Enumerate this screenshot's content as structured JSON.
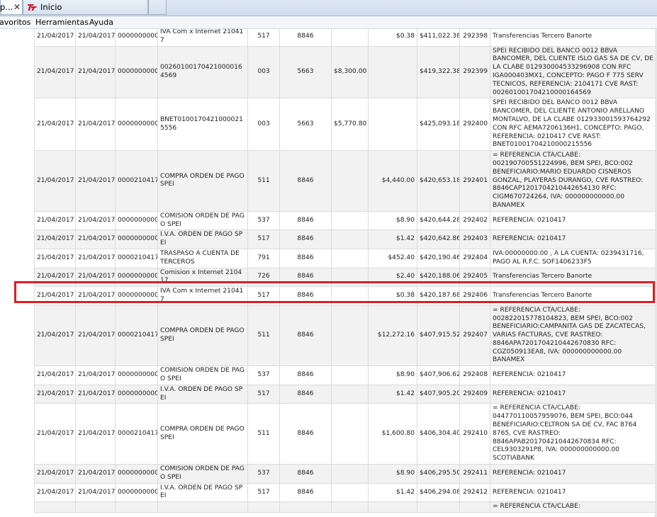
{
  "tabs": {
    "active": {
      "title": "p...",
      "close": "✕"
    },
    "inactive": {
      "title": "Inicio"
    }
  },
  "menu": {
    "favoritos": "avoritos",
    "herramientas": "Herramientas",
    "ayuda": "Ayuda"
  },
  "colors": {
    "highlight": "#e01c24",
    "logo": "#d3122a"
  },
  "rows": [
    {
      "fecha1": "21/04/2017",
      "fecha2": "21/04/2017",
      "ref": "0000000000",
      "desc": "IVA Com x Internet 210417",
      "cod": "517",
      "suc": "8846",
      "deposito": "",
      "retiro": "$0.38",
      "saldo": "$411,022.38",
      "mov": "292398",
      "referencia": "Transferencias Tercero Banorte"
    },
    {
      "fecha1": "21/04/2017",
      "fecha2": "21/04/2017",
      "ref": "0000000000",
      "desc": "002601001704210000164569",
      "cod": "003",
      "suc": "5663",
      "deposito": "$8,300.00",
      "retiro": "",
      "saldo": "$419,322.38",
      "mov": "292399",
      "referencia": "SPEI RECIBIDO DEL BANCO 0012 BBVA BANCOMER, DEL CLIENTE ISLO GAS SA DE CV, DE LA CLABE 012930004533296908 CON RFC IGA000403MX1, CONCEPTO: PAGO F 775 SERV TECNICOS, REFERENCIA: 2104171 CVE RAST: 002601001704210000164569"
    },
    {
      "fecha1": "21/04/2017",
      "fecha2": "21/04/2017",
      "ref": "0000000000",
      "desc": "BNET01001704210000215556",
      "cod": "003",
      "suc": "5663",
      "deposito": "$5,770.80",
      "retiro": "",
      "saldo": "$425,093.18",
      "mov": "292400",
      "referencia": "SPEI RECIBIDO DEL BANCO 0012 BBVA BANCOMER, DEL CLIENTE ANTONIO ARELLANO MONTALVO, DE LA CLABE 012933001593764292 CON RFC AEMA7206136H1, CONCEPTO: PAGO, REFERENCIA: 0210417 CVE RAST: BNET01001704210000215556"
    },
    {
      "fecha1": "21/04/2017",
      "fecha2": "21/04/2017",
      "ref": "0000210417",
      "desc": "COMPRA ORDEN DE PAGO SPEI",
      "cod": "511",
      "suc": "8846",
      "deposito": "",
      "retiro": "$4,440.00",
      "saldo": "$420,653.18",
      "mov": "292401",
      "referencia": "= REFERENCIA CTA/CLABE: 002190700551224996, BEM SPEI, BCO:002 BENEFICIARIO:MARIO EDUARDO CISNEROS GONZAL, PLAYERAS DURANGO, CVE RASTREO: 8846CAP1201704210442654130 RFC: CIGM670724264, IVA: 000000000000.00 BANAMEX"
    },
    {
      "fecha1": "21/04/2017",
      "fecha2": "21/04/2017",
      "ref": "0000000000",
      "desc": "COMISION ORDEN DE PAGO SPEI",
      "cod": "537",
      "suc": "8846",
      "deposito": "",
      "retiro": "$8.90",
      "saldo": "$420,644.28",
      "mov": "292402",
      "referencia": "REFERENCIA: 0210417"
    },
    {
      "fecha1": "21/04/2017",
      "fecha2": "21/04/2017",
      "ref": "0000000000",
      "desc": "I.V.A. ORDEN DE PAGO SPEI",
      "cod": "517",
      "suc": "8846",
      "deposito": "",
      "retiro": "$1.42",
      "saldo": "$420,642.86",
      "mov": "292403",
      "referencia": "REFERENCIA: 0210417"
    },
    {
      "fecha1": "21/04/2017",
      "fecha2": "21/04/2017",
      "ref": "0000210417",
      "desc": "TRASPASO A CUENTA DE TERCEROS",
      "cod": "791",
      "suc": "8846",
      "deposito": "",
      "retiro": "$452.40",
      "saldo": "$420,190.46",
      "mov": "292404",
      "referencia": "IVA:00000000.00 , A LA CUENTA: 0239431716, PAGO AL R.F.C. SOF1406233F5"
    },
    {
      "fecha1": "21/04/2017",
      "fecha2": "21/04/2017",
      "ref": "0000000000",
      "desc": "Comision x Internet 210417",
      "cod": "726",
      "suc": "8846",
      "deposito": "",
      "retiro": "$2.40",
      "saldo": "$420,188.06",
      "mov": "292405",
      "referencia": "Transferencias Tercero Banorte"
    },
    {
      "fecha1": "21/04/2017",
      "fecha2": "21/04/2017",
      "ref": "0000000000",
      "desc": "IVA Com x Internet 210417",
      "cod": "517",
      "suc": "8846",
      "deposito": "",
      "retiro": "$0.38",
      "saldo": "$420,187.68",
      "mov": "292406",
      "referencia": "Transferencias Tercero Banorte"
    },
    {
      "fecha1": "21/04/2017",
      "fecha2": "21/04/2017",
      "ref": "0000210417",
      "desc": "COMPRA ORDEN DE PAGO SPEI",
      "cod": "511",
      "suc": "8846",
      "deposito": "",
      "retiro": "$12,272.16",
      "saldo": "$407,915.52",
      "mov": "292407",
      "referencia": "= REFERENCIA CTA/CLABE: 002822015778104823, BEM SPEI, BCO:002 BENEFICIARIO:CAMPANITA GAS DE ZACATECAS, VARIAS FACTURAS, CVE RASTREO: 8846APA7201704210442670830 RFC: CGZ050913EA8, IVA: 000000000000.00 BANAMEX"
    },
    {
      "fecha1": "21/04/2017",
      "fecha2": "21/04/2017",
      "ref": "0000000000",
      "desc": "COMISION ORDEN DE PAGO SPEI",
      "cod": "537",
      "suc": "8846",
      "deposito": "",
      "retiro": "$8.90",
      "saldo": "$407,906.62",
      "mov": "292408",
      "referencia": "REFERENCIA: 0210417"
    },
    {
      "fecha1": "21/04/2017",
      "fecha2": "21/04/2017",
      "ref": "0000000000",
      "desc": "I.V.A. ORDEN DE PAGO SPEI",
      "cod": "517",
      "suc": "8846",
      "deposito": "",
      "retiro": "$1.42",
      "saldo": "$407,905.20",
      "mov": "292409",
      "referencia": "REFERENCIA: 0210417"
    },
    {
      "fecha1": "21/04/2017",
      "fecha2": "21/04/2017",
      "ref": "0000210417",
      "desc": "COMPRA ORDEN DE PAGO SPEI",
      "cod": "511",
      "suc": "8846",
      "deposito": "",
      "retiro": "$1,600.80",
      "saldo": "$406,304.40",
      "mov": "292410",
      "referencia": "= REFERENCIA CTA/CLABE: 044770110057959076, BEM SPEI, BCO:044 BENEFICIARIO:CELTRON SA DE CV, FAC 8764 8765, CVE RASTREO: 8846APAB201704210442670834 RFC: CEL9303291P8, IVA: 000000000000.00 SCOTIABANK"
    },
    {
      "fecha1": "21/04/2017",
      "fecha2": "21/04/2017",
      "ref": "0000000000",
      "desc": "COMISION ORDEN DE PAGO SPEI",
      "cod": "537",
      "suc": "8846",
      "deposito": "",
      "retiro": "$8.90",
      "saldo": "$406,295.50",
      "mov": "292411",
      "referencia": "REFERENCIA: 0210417"
    },
    {
      "fecha1": "21/04/2017",
      "fecha2": "21/04/2017",
      "ref": "0000000000",
      "desc": "I.V.A. ORDEN DE PAGO SPEI",
      "cod": "517",
      "suc": "8846",
      "deposito": "",
      "retiro": "$1.42",
      "saldo": "$406,294.08",
      "mov": "292412",
      "referencia": "REFERENCIA: 0210417"
    },
    {
      "fecha1": "",
      "fecha2": "",
      "ref": "",
      "desc": "",
      "cod": "",
      "suc": "",
      "deposito": "",
      "retiro": "",
      "saldo": "",
      "mov": "",
      "referencia": "= REFERENCIA CTA/CLABE:"
    }
  ]
}
